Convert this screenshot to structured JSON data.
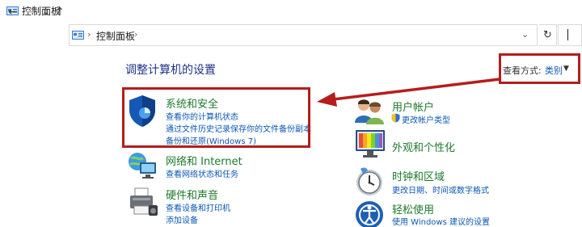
{
  "window": {
    "title": "控制面板"
  },
  "nav": {
    "back": "←",
    "forward": "→",
    "recent": "⌄",
    "up": "↑",
    "refresh": "↻"
  },
  "address": {
    "path": "控制面板",
    "separator": "›",
    "dropdown": "⌄"
  },
  "main": {
    "heading": "调整计算机的设置",
    "view_by_label": "查看方式:",
    "view_by_value": "类别",
    "view_by_caret": "▼"
  },
  "left_categories": [
    {
      "title": "系统和安全",
      "links": [
        "查看你的计算机状态",
        "通过文件历史记录保存你的文件备份副本",
        "备份和还原(Windows 7)"
      ],
      "icon": "shield-icon"
    },
    {
      "title": "网络和 Internet",
      "links": [
        "查看网络状态和任务"
      ],
      "icon": "network-icon"
    },
    {
      "title": "硬件和声音",
      "links": [
        "查看设备和打印机",
        "添加设备"
      ],
      "icon": "printer-icon"
    }
  ],
  "right_categories": [
    {
      "title": "用户帐户",
      "links": [
        "更改帐户类型"
      ],
      "icon": "users-icon"
    },
    {
      "title": "外观和个性化",
      "links": [],
      "icon": "monitor-icon"
    },
    {
      "title": "时钟和区域",
      "links": [
        "更改日期、时间或数字格式"
      ],
      "icon": "clock-icon"
    },
    {
      "title": "轻松使用",
      "links": [
        "使用 Windows 建议的设置"
      ],
      "icon": "accessibility-icon"
    }
  ],
  "colors": {
    "callout": "#b51d1d",
    "link": "#0b57b5",
    "category_title": "#1e7a2c",
    "heading": "#1e3287"
  }
}
